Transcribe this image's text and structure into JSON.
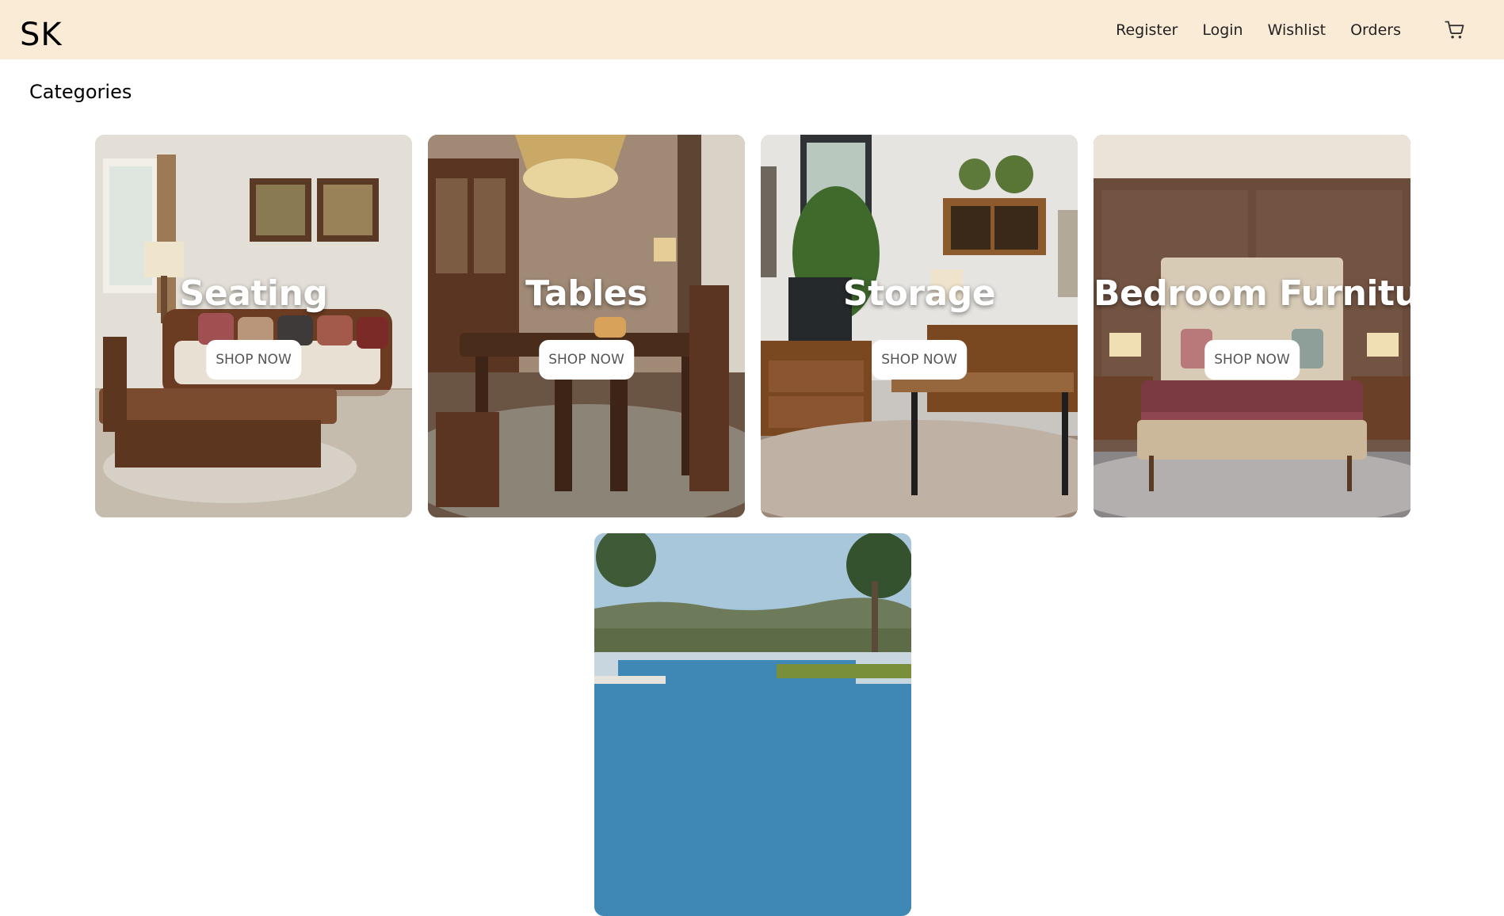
{
  "header": {
    "logo": "SK",
    "nav": [
      "Register",
      "Login",
      "Wishlist",
      "Orders"
    ],
    "cart_icon": "shopping-cart-icon",
    "bg_color": "#faebd7"
  },
  "main": {
    "title": "Categories",
    "categories": [
      {
        "title": "Seating",
        "button": "SHOP NOW",
        "image": "living-room-sofa-photo"
      },
      {
        "title": "Tables",
        "button": "SHOP NOW",
        "image": "dining-room-table-photo"
      },
      {
        "title": "Storage",
        "button": "SHOP NOW",
        "image": "storage-cabinet-photo"
      },
      {
        "title": "Bedroom Furniture",
        "button": "SHOP NOW",
        "image": "bedroom-bed-photo"
      },
      {
        "title": "",
        "button": "",
        "image": "outdoor-pool-photo"
      }
    ]
  }
}
